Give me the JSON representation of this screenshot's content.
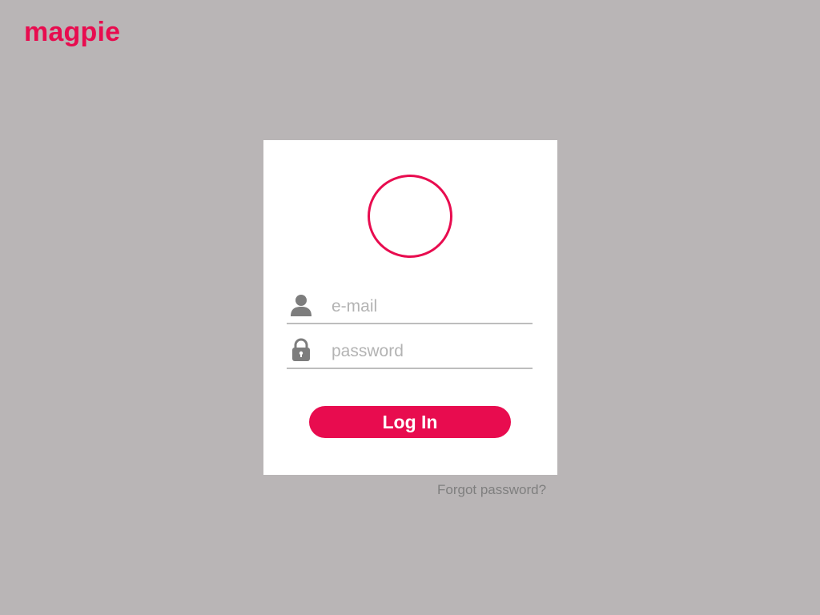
{
  "brand": {
    "name": "magpie",
    "color": "#e80c4f"
  },
  "login_card": {
    "avatar_icon": "avatar-placeholder-circle",
    "email_field": {
      "icon": "user-icon",
      "placeholder": "e-mail",
      "value": ""
    },
    "password_field": {
      "icon": "lock-icon",
      "placeholder": "password",
      "value": ""
    },
    "login_button_label": "Log In"
  },
  "forgot_password_link": "Forgot password?",
  "colors": {
    "background": "#b9b5b6",
    "accent": "#e80c4f",
    "icon": "#7d7d7d",
    "card": "#ffffff"
  }
}
